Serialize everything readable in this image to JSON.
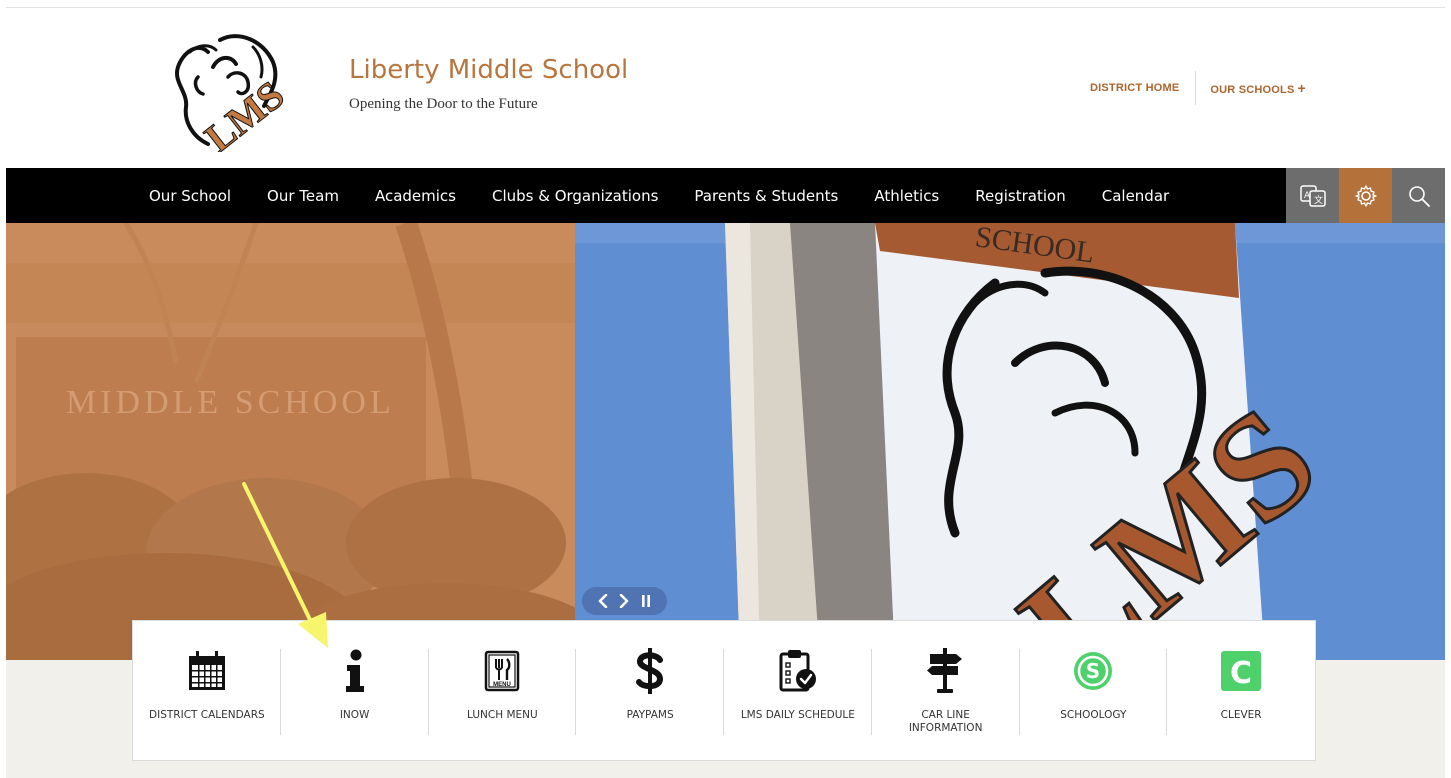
{
  "header": {
    "logo_text": "LMS",
    "school_name": "Liberty Middle School",
    "tagline": "Opening the Door to the Future"
  },
  "utility_nav": {
    "district_home": "DISTRICT HOME",
    "our_schools": "OUR SCHOOLS",
    "our_schools_icon": "plus-icon"
  },
  "main_nav": {
    "items": [
      {
        "label": "Our School"
      },
      {
        "label": "Our Team"
      },
      {
        "label": "Academics"
      },
      {
        "label": "Clubs & Organizations"
      },
      {
        "label": "Parents & Students"
      },
      {
        "label": "Athletics"
      },
      {
        "label": "Registration"
      },
      {
        "label": "Calendar"
      }
    ],
    "tools": [
      {
        "icon": "translate-icon",
        "color": "#6d6d6d"
      },
      {
        "icon": "gear-icon",
        "color": "#b5713a"
      },
      {
        "icon": "search-icon",
        "color": "#6d6d6d"
      }
    ]
  },
  "hero": {
    "left_sign_text": "MIDDLE SCHOOL",
    "banner_top_text": "SCHOOL",
    "banner_logo_text": "LMS",
    "controls": [
      "previous-icon",
      "next-icon",
      "pause-icon"
    ]
  },
  "quick_links": [
    {
      "label": "DISTRICT CALENDARS",
      "icon": "calendar-icon"
    },
    {
      "label": "INOW",
      "icon": "info-icon"
    },
    {
      "label": "LUNCH MENU",
      "icon": "menu-icon",
      "icon_text": "MENU"
    },
    {
      "label": "PAYPAMS",
      "icon": "dollar-icon"
    },
    {
      "label": "LMS DAILY SCHEDULE",
      "icon": "clipboard-check-icon"
    },
    {
      "label": "CAR LINE\nINFORMATION",
      "icon": "signpost-icon"
    },
    {
      "label": "SCHOOLOGY",
      "icon": "schoology-icon",
      "color": "#4ed16a"
    },
    {
      "label": "CLEVER",
      "icon": "clever-icon",
      "color": "#4ed16a",
      "icon_text": "C"
    }
  ],
  "colors": {
    "brand_orange": "#b8763e",
    "nav_bg": "#000000",
    "annotation_arrow": "#f7f56b"
  }
}
